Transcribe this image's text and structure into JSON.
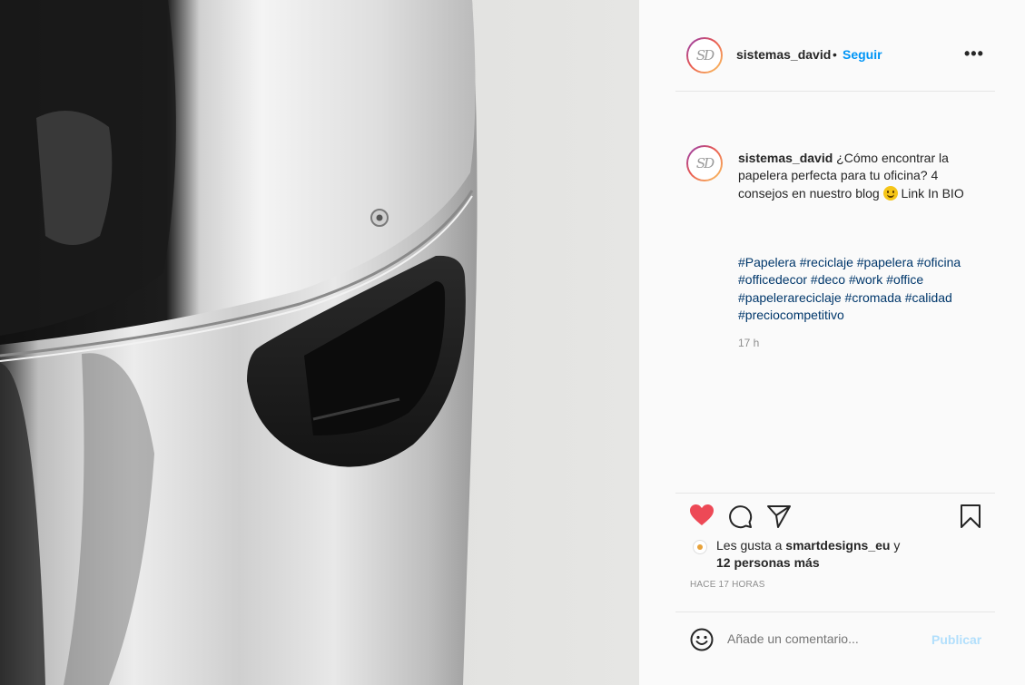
{
  "header": {
    "avatar_text": "SD",
    "username": "sistemas_david",
    "dot": "•",
    "follow_label": "Seguir",
    "more_icon": "more-horizontal-icon",
    "more_glyph": "•••"
  },
  "caption": {
    "username": "sistemas_david",
    "text_part1": " ¿Cómo encontrar la papelera perfecta para tu oficina? 4 consejos en nuestro blog ",
    "emoji_icon": "smiling-face-emoji",
    "text_part2": " Link In BIO",
    "hashtags": [
      "#Papelera",
      "#reciclaje",
      "#papelera",
      "#oficina",
      "#officedecor",
      "#deco",
      "#work",
      "#office",
      "#papelerareciclaje",
      "#cromada",
      "#calidad",
      "#preciocompetitivo"
    ],
    "time": "17 h"
  },
  "actions": {
    "like_icon": "heart-filled-icon",
    "comment_icon": "comment-icon",
    "share_icon": "share-paper-plane-icon",
    "save_icon": "bookmark-icon",
    "like_color": "#ed4956"
  },
  "likes": {
    "prefix": "Les gusta a ",
    "user": "smartdesigns_eu",
    "connector": " y",
    "others": "12 personas más"
  },
  "ago": "HACE 17 HORAS",
  "comment": {
    "emoji_icon": "smiley-face-icon",
    "placeholder": "Añade un comentario...",
    "publish_label": "Publicar"
  },
  "colors": {
    "link_blue": "#0095f6",
    "hashtag": "#00376b",
    "publish_disabled": "#b2dffc"
  }
}
